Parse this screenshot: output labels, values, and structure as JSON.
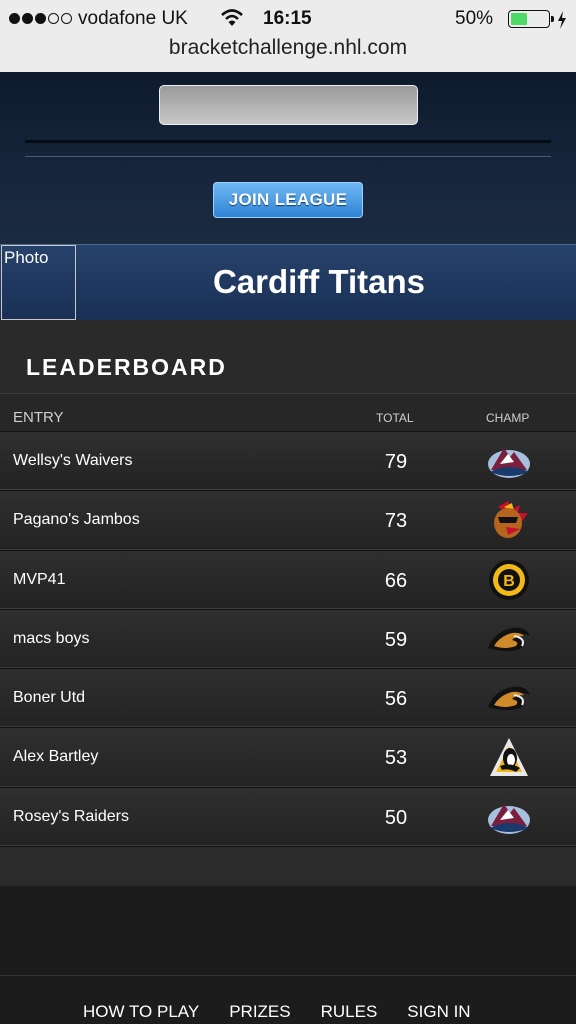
{
  "status_bar": {
    "carrier": "vodafone UK",
    "time": "16:15",
    "battery": "50%",
    "battery_level": 0.5,
    "signal_bars": 3,
    "url": "bracketchallenge.nhl.com"
  },
  "header": {
    "code_input_value": "",
    "join_label": "JOIN LEAGUE",
    "accent_color": "#3a8fe0"
  },
  "team": {
    "photo_label": "Photo",
    "name": "Cardiff Titans"
  },
  "leaderboard": {
    "title": "LEADERBOARD",
    "columns": {
      "entry": "ENTRY",
      "total": "TOTAL",
      "champ": "CHAMP"
    },
    "rows": [
      {
        "entry": "Wellsy's Waivers",
        "total": "79",
        "champ_icon": "avalanche-logo-icon"
      },
      {
        "entry": "Pagano's Jambos",
        "total": "73",
        "champ_icon": "blackhawks-logo-icon"
      },
      {
        "entry": "MVP41",
        "total": "66",
        "champ_icon": "bruins-logo-icon"
      },
      {
        "entry": "macs boys",
        "total": "59",
        "champ_icon": "ducks-logo-icon"
      },
      {
        "entry": "Boner Utd",
        "total": "56",
        "champ_icon": "ducks-logo-icon"
      },
      {
        "entry": "Alex Bartley",
        "total": "53",
        "champ_icon": "penguins-logo-icon"
      },
      {
        "entry": "Rosey's Raiders",
        "total": "50",
        "champ_icon": "avalanche-logo-icon"
      }
    ]
  },
  "footer": {
    "nav": [
      "HOW TO PLAY",
      "PRIZES",
      "RULES",
      "SIGN IN"
    ]
  }
}
